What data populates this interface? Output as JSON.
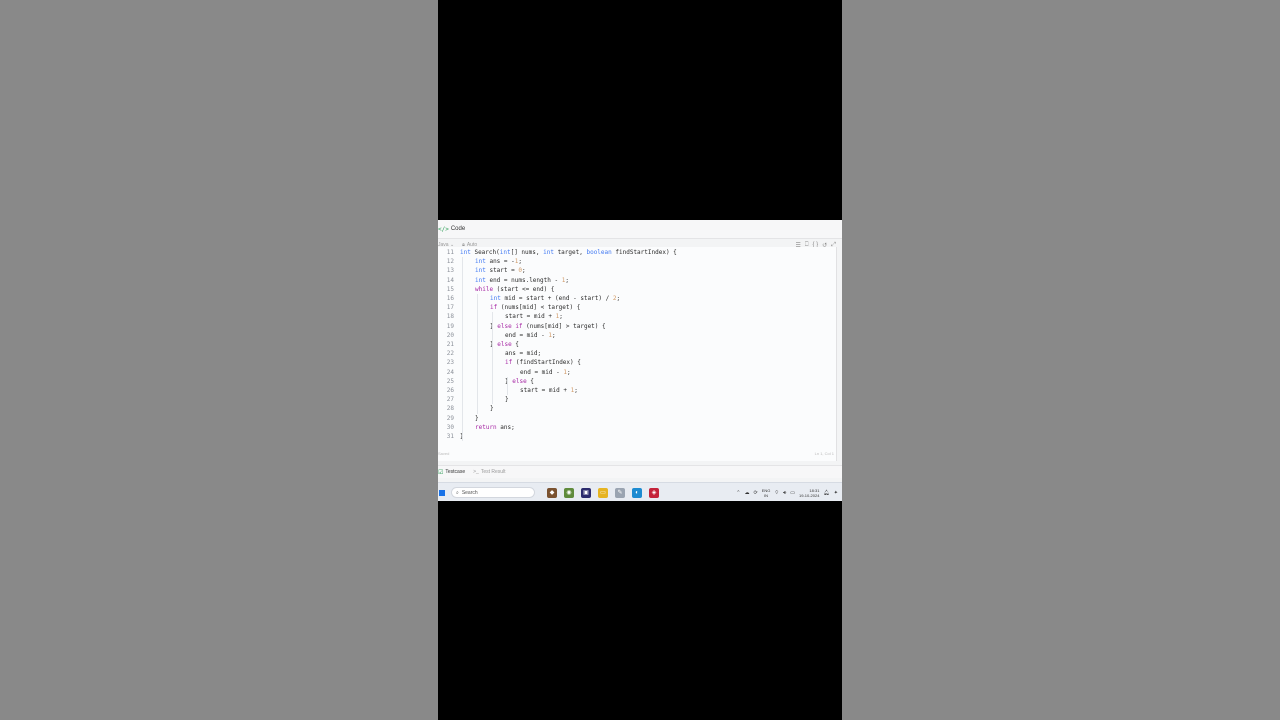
{
  "panel": {
    "title": "Code",
    "icon": "code-icon"
  },
  "toolbar": {
    "language": "Java",
    "mode": "Auto",
    "tools": [
      "format-icon",
      "bookmark-icon",
      "braces-icon",
      "reset-icon",
      "expand-icon"
    ]
  },
  "code": {
    "lines": [
      {
        "n": "11",
        "indent": 1,
        "text": "int Search(int[] nums, int target, boolean findStartIndex) {"
      },
      {
        "n": "12",
        "indent": 2,
        "text": "int ans = -1;"
      },
      {
        "n": "13",
        "indent": 2,
        "text": "int start = 0;"
      },
      {
        "n": "14",
        "indent": 2,
        "text": "int end = nums.length - 1;"
      },
      {
        "n": "15",
        "indent": 2,
        "text": "while (start <= end) {"
      },
      {
        "n": "16",
        "indent": 3,
        "text": "int mid = start + (end - start) / 2;"
      },
      {
        "n": "17",
        "indent": 3,
        "text": "if (nums[mid] < target) {"
      },
      {
        "n": "18",
        "indent": 4,
        "text": "start = mid + 1;"
      },
      {
        "n": "19",
        "indent": 3,
        "text": "} else if (nums[mid] > target) {"
      },
      {
        "n": "20",
        "indent": 4,
        "text": "end = mid - 1;"
      },
      {
        "n": "21",
        "indent": 3,
        "text": "} else {"
      },
      {
        "n": "22",
        "indent": 4,
        "text": "ans = mid;"
      },
      {
        "n": "23",
        "indent": 4,
        "text": "if (findStartIndex) {"
      },
      {
        "n": "24",
        "indent": 5,
        "text": "end = mid - 1;"
      },
      {
        "n": "25",
        "indent": 4,
        "text": "} else {"
      },
      {
        "n": "26",
        "indent": 5,
        "text": "start = mid + 1;"
      },
      {
        "n": "27",
        "indent": 4,
        "text": "}"
      },
      {
        "n": "28",
        "indent": 3,
        "text": "}"
      },
      {
        "n": "29",
        "indent": 2,
        "text": "}"
      },
      {
        "n": "30",
        "indent": 2,
        "text": "return ans;"
      },
      {
        "n": "31",
        "indent": 1,
        "text": "}"
      }
    ]
  },
  "status": {
    "left": "Saved",
    "right": "Ln 1, Col 1"
  },
  "tabs": [
    {
      "label": "Testcase",
      "active": true
    },
    {
      "label": "Test Result",
      "active": false
    }
  ],
  "taskbar": {
    "search_placeholder": "Search",
    "tray": {
      "lang_line1": "ENG",
      "lang_line2": "IN",
      "time": "18:31",
      "date": "19-10-2024"
    }
  },
  "colors": {
    "keyword": "#a626a4",
    "type": "#4078f2",
    "number": "#d19a66",
    "accent": "#2e9e57"
  }
}
